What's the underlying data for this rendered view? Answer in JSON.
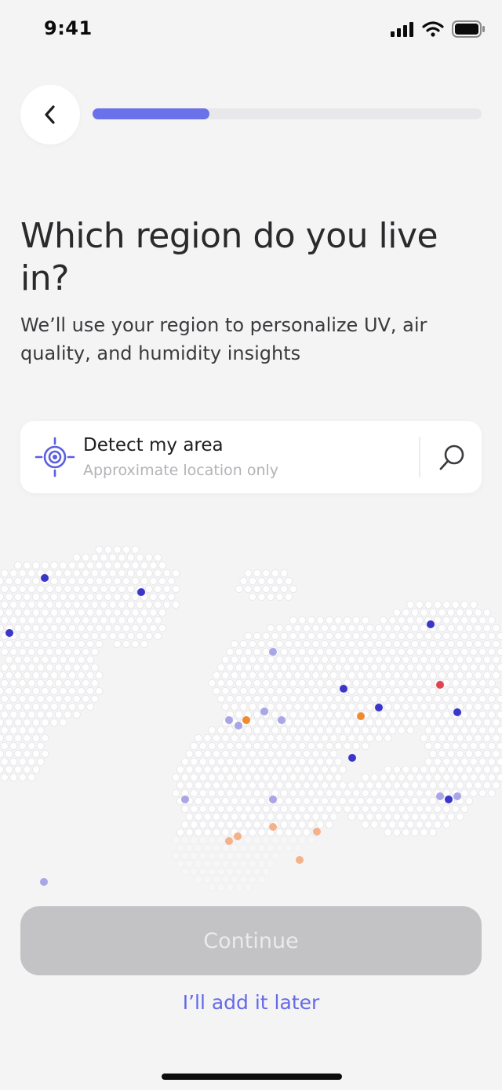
{
  "status_bar": {
    "time": "9:41",
    "icons": [
      "cellular-signal-icon",
      "wifi-icon",
      "battery-icon"
    ]
  },
  "header": {
    "back_icon": "chevron-left-icon",
    "progress_fraction": 0.3,
    "progress_color": "#6b71e8"
  },
  "title": "Which region do you live in?",
  "subtitle": "We’ll use your region to personalize UV, air quality, and humidity insights",
  "detect": {
    "label": "Detect my area",
    "sublabel": "Approximate location only",
    "icon": "location-target-icon",
    "search_icon": "search-icon",
    "accent": "#5b5fe0"
  },
  "map": {
    "icon": "hex-world-map",
    "dot_colors": {
      "blue": "#3a36c9",
      "lavender": "#a9a6e6",
      "orange": "#f08a2e",
      "red": "#e2444f",
      "peach": "#f3b28a"
    }
  },
  "actions": {
    "continue_label": "Continue",
    "later_label": "I’ll add it later",
    "continue_bg": "#c3c3c5",
    "link_color": "#6469e6"
  }
}
